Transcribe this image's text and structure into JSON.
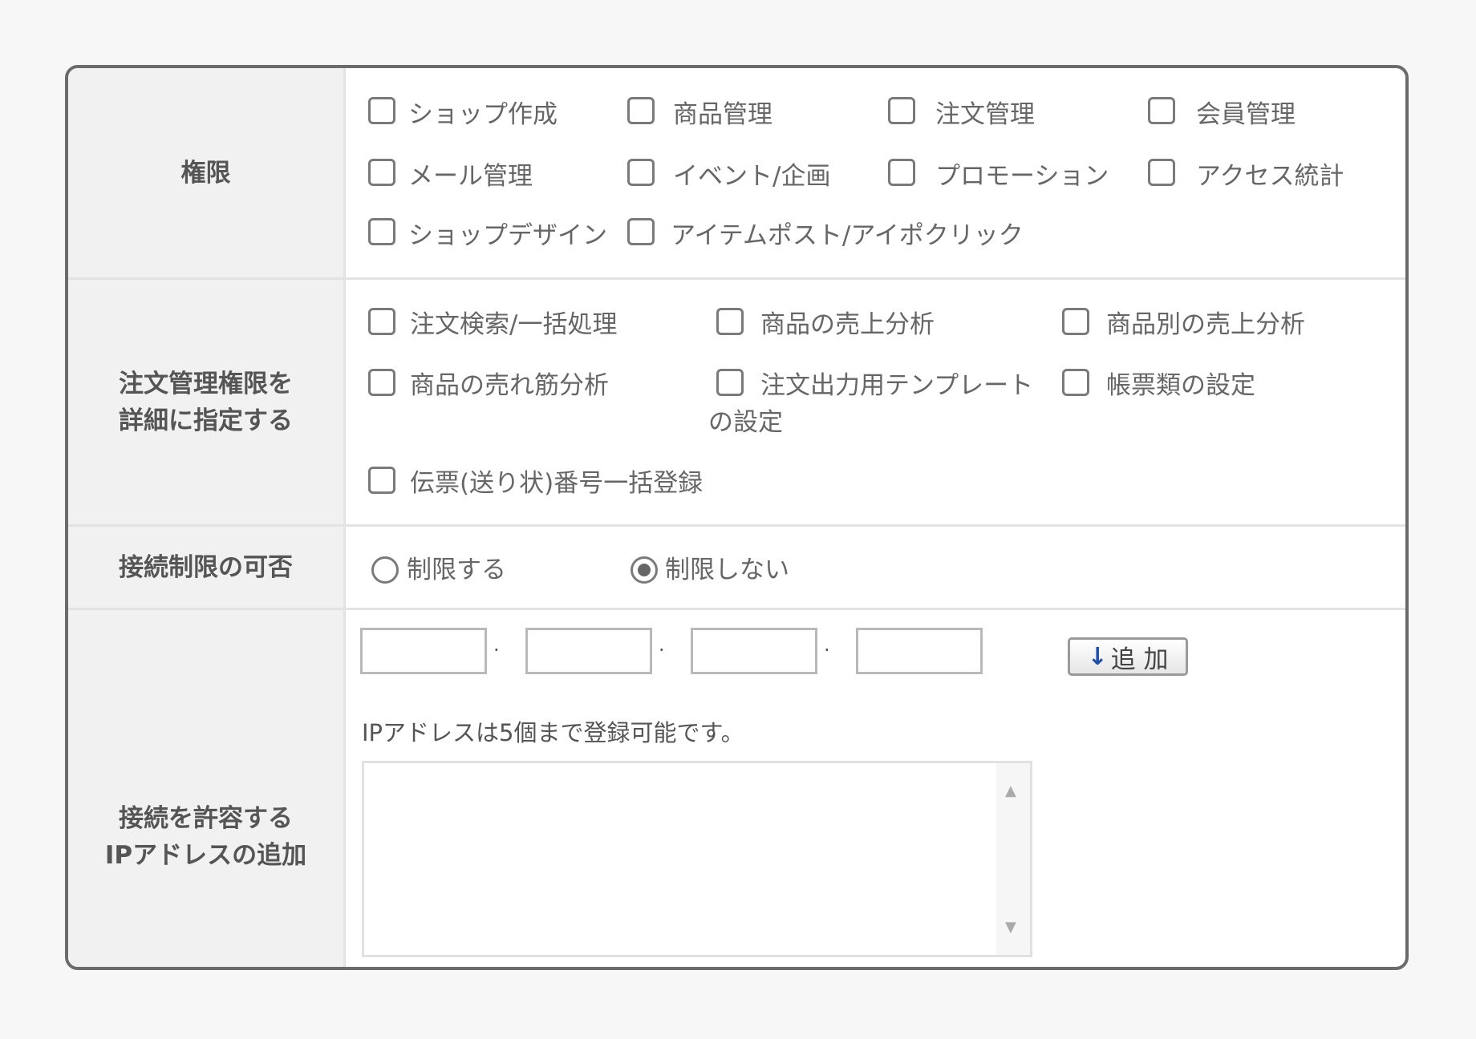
{
  "permissions": {
    "label": "権限",
    "options": [
      "ショップ作成",
      "商品管理",
      "注文管理",
      "会員管理",
      "メール管理",
      "イベント/企画",
      "プロモーション",
      "アクセス統計",
      "ショップデザイン",
      "アイテムポスト/アイポクリック"
    ]
  },
  "order_permissions": {
    "label_line1": "注文管理権限を",
    "label_line2": "詳細に指定する",
    "options": [
      "注文検索/一括処理",
      "商品の売上分析",
      "商品別の売上分析",
      "商品の売れ筋分析",
      "注文出力用テンプレート",
      "帳票類の設定",
      "伝票(送り状)番号一括登録"
    ],
    "template_option_line2": "の設定"
  },
  "connection_limit": {
    "label": "接続制限の可否",
    "options": [
      "制限する",
      "制限しない"
    ],
    "selected": "制限しない"
  },
  "ip_allow": {
    "label_line1": "接続を許容する",
    "label_line2": "IPアドレスの追加",
    "separator": "·",
    "add_button": "追 加",
    "note": "IPアドレスは5個まで登録可能です。",
    "ip_octets": [
      "",
      "",
      "",
      ""
    ]
  }
}
